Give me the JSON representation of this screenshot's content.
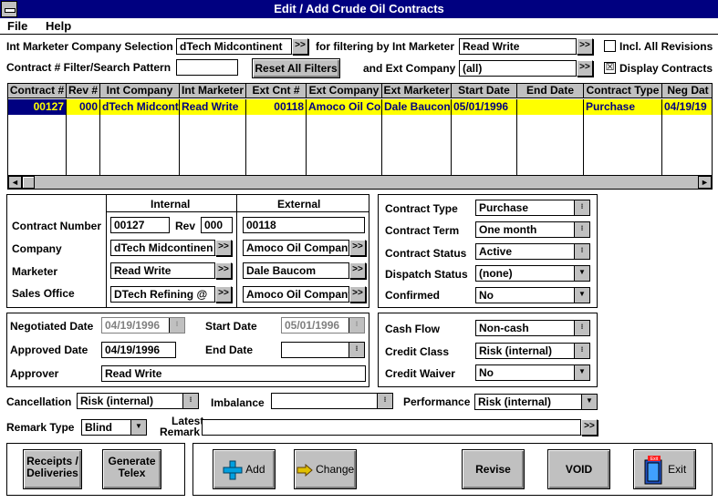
{
  "window": {
    "title": "Edit / Add Crude Oil Contracts"
  },
  "menu": {
    "file": "File",
    "help": "Help"
  },
  "filters": {
    "int_marketer_company_label": "Int Marketer Company Selection",
    "int_marketer_company_value": "dTech Midcontinent",
    "for_filtering_label": "for filtering by Int Marketer",
    "int_marketer_value": "Read Write",
    "incl_all_revisions_label": "Incl. All Revisions",
    "contract_filter_label": "Contract # Filter/Search Pattern",
    "contract_filter_value": "",
    "reset_button": "Reset All Filters",
    "ext_company_label": "and Ext Company",
    "ext_company_value": "(all)",
    "display_contracts_label": "Display Contracts",
    "display_contracts_checked": "☒"
  },
  "grid": {
    "headers": [
      "Contract #",
      "Rev #",
      "Int Company",
      "Int Marketer",
      "Ext Cnt #",
      "Ext Company",
      "Ext Marketer",
      "Start Date",
      "End Date",
      "Contract Type",
      "Neg Dat"
    ],
    "rows": [
      [
        "00127",
        "000",
        "dTech Midcont",
        "Read Write",
        "00118",
        "Amoco Oil Cor",
        "Dale Baucon",
        "05/01/1996",
        "",
        "Purchase",
        "04/19/19"
      ]
    ]
  },
  "contract": {
    "internal_header": "Internal",
    "external_header": "External",
    "contract_number_label": "Contract Number",
    "contract_number": "00127",
    "rev_label": "Rev",
    "rev": "000",
    "ext_contract_number": "00118",
    "company_label": "Company",
    "int_company": "dTech Midcontinen",
    "ext_company": "Amoco Oil Company",
    "marketer_label": "Marketer",
    "int_marketer": "Read Write",
    "ext_marketer": "Dale Baucom",
    "sales_office_label": "Sales Office",
    "int_sales_office": "DTech Refining @",
    "ext_sales_office": "Amoco Oil Company"
  },
  "contract_attrs": {
    "type_label": "Contract Type",
    "type_value": "Purchase",
    "term_label": "Contract Term",
    "term_value": "One month",
    "status_label": "Contract Status",
    "status_value": "Active",
    "dispatch_label": "Dispatch Status",
    "dispatch_value": "(none)",
    "confirmed_label": "Confirmed",
    "confirmed_value": "No"
  },
  "dates": {
    "negotiated_label": "Negotiated Date",
    "negotiated_value": "04/19/1996",
    "start_label": "Start Date",
    "start_value": "05/01/1996",
    "approved_label": "Approved Date",
    "approved_value": "04/19/1996",
    "end_label": "End Date",
    "end_value": "",
    "approver_label": "Approver",
    "approver_value": "Read Write"
  },
  "credit": {
    "cash_flow_label": "Cash Flow",
    "cash_flow_value": "Non-cash",
    "credit_class_label": "Credit Class",
    "credit_class_value": "Risk (internal)",
    "credit_waiver_label": "Credit Waiver",
    "credit_waiver_value": "No"
  },
  "misc": {
    "cancellation_label": "Cancellation",
    "cancellation_value": "Risk (internal)",
    "imbalance_label": "Imbalance",
    "imbalance_value": "",
    "performance_label": "Performance",
    "performance_value": "Risk (internal)",
    "remark_type_label": "Remark Type",
    "remark_type_value": "Blind",
    "latest_label": "Latest",
    "remark_label": "Remark",
    "latest_remark_value": ""
  },
  "buttons": {
    "receipts_line1": "Receipts /",
    "receipts_line2": "Deliveries",
    "generate_line1": "Generate",
    "generate_line2": "Telex",
    "add": "Add",
    "change": "Change",
    "revise": "Revise",
    "void": "VOID",
    "exit": "Exit",
    "exit_icon_text": "Exit"
  },
  "colors": {
    "title_bg": "#000080",
    "selection_bg": "#ffff00",
    "selection_text": "#000080",
    "button_face": "#c0c0c0",
    "add_icon": "#00a0e0",
    "change_icon": "#e0c000"
  }
}
